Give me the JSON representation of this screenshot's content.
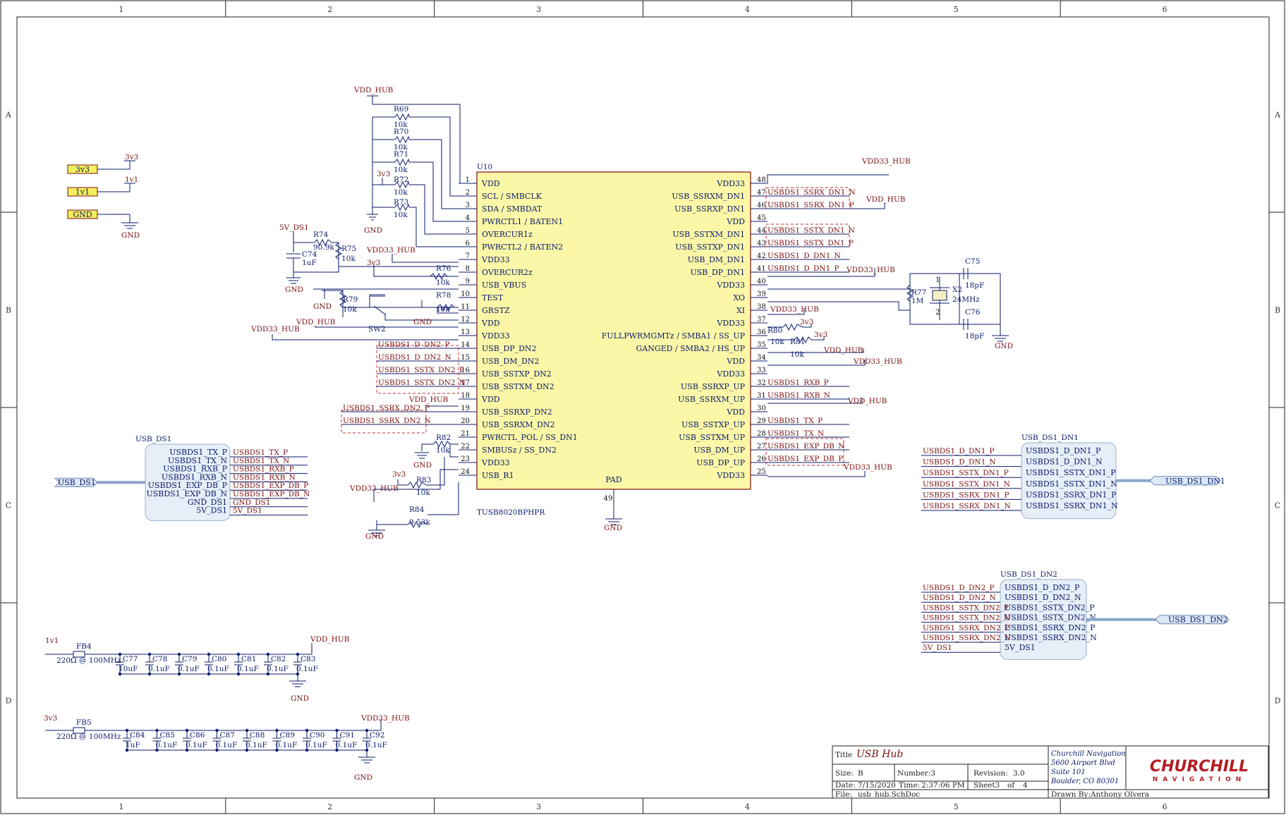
{
  "zones": {
    "columns": [
      "1",
      "2",
      "3",
      "4",
      "5",
      "6"
    ],
    "rows": [
      "A",
      "B",
      "C",
      "D"
    ]
  },
  "power_labels": {
    "top_left_ports": [
      {
        "label": "3v3",
        "net": "3v3"
      },
      {
        "label": "1v1",
        "net": "1v1"
      },
      {
        "label": "GND",
        "net": "GND"
      }
    ]
  },
  "ic": {
    "ref": "U10",
    "part": "TUSB8020BPHPR",
    "left_pins": [
      {
        "num": "1",
        "name": "VDD"
      },
      {
        "num": "2",
        "name": "SCL / SMBCLK"
      },
      {
        "num": "3",
        "name": "SDA / SMBDAT"
      },
      {
        "num": "4",
        "name": "PWRCTL1 / BATEN1"
      },
      {
        "num": "5",
        "name": "OVERCUR1z"
      },
      {
        "num": "6",
        "name": "PWRCTL2 / BATEN2"
      },
      {
        "num": "7",
        "name": "VDD33"
      },
      {
        "num": "8",
        "name": "OVERCUR2z"
      },
      {
        "num": "9",
        "name": "USB_VBUS"
      },
      {
        "num": "10",
        "name": "TEST"
      },
      {
        "num": "11",
        "name": "GRSTZ"
      },
      {
        "num": "12",
        "name": "VDD"
      },
      {
        "num": "13",
        "name": "VDD33"
      },
      {
        "num": "14",
        "name": "USB_DP_DN2"
      },
      {
        "num": "15",
        "name": "USB_DM_DN2"
      },
      {
        "num": "16",
        "name": "USB_SSTXP_DN2"
      },
      {
        "num": "17",
        "name": "USB_SSTXM_DN2"
      },
      {
        "num": "18",
        "name": "VDD"
      },
      {
        "num": "19",
        "name": "USB_SSRXP_DN2"
      },
      {
        "num": "20",
        "name": "USB_SSRXM_DN2"
      },
      {
        "num": "21",
        "name": "PWRCTL_POL / SS_DN1"
      },
      {
        "num": "22",
        "name": "SMBUSz / SS_DN2"
      },
      {
        "num": "23",
        "name": "VDD33"
      },
      {
        "num": "24",
        "name": "USB_R1"
      }
    ],
    "right_pins": [
      {
        "num": "48",
        "name": "VDD33"
      },
      {
        "num": "47",
        "name": "USB_SSRXM_DN1"
      },
      {
        "num": "46",
        "name": "USB_SSRXP_DN1"
      },
      {
        "num": "45",
        "name": "VDD"
      },
      {
        "num": "44",
        "name": "USB_SSTXM_DN1"
      },
      {
        "num": "43",
        "name": "USB_SSTXP_DN1"
      },
      {
        "num": "42",
        "name": "USB_DM_DN1"
      },
      {
        "num": "41",
        "name": "USB_DP_DN1"
      },
      {
        "num": "40",
        "name": "VDD33"
      },
      {
        "num": "39",
        "name": "XO"
      },
      {
        "num": "38",
        "name": "XI"
      },
      {
        "num": "37",
        "name": "VDD33"
      },
      {
        "num": "36",
        "name": "FULLPWRMGMTz / SMBA1 / SS_UP"
      },
      {
        "num": "35",
        "name": "GANGED / SMBA2 / HS_UP"
      },
      {
        "num": "34",
        "name": "VDD"
      },
      {
        "num": "33",
        "name": "VDD33"
      },
      {
        "num": "32",
        "name": "USB_SSRXP_UP"
      },
      {
        "num": "31",
        "name": "USB_SSRXM_UP"
      },
      {
        "num": "30",
        "name": "VDD"
      },
      {
        "num": "29",
        "name": "USB_SSTXP_UP"
      },
      {
        "num": "28",
        "name": "USB_SSTXM_UP"
      },
      {
        "num": "27",
        "name": "USB_DM_UP"
      },
      {
        "num": "26",
        "name": "USB_DP_UP"
      },
      {
        "num": "25",
        "name": "VDD33"
      }
    ],
    "pad_label": "PAD",
    "pad_num": "49"
  },
  "right_nets": {
    "r47": "USBDS1_SSRX_DN1_N",
    "r46": "USBDS1_SSRX_DN1_P",
    "r44": "USBDS1_SSTX_DN1_N",
    "r43": "USBDS1_SSTX_DN1_P",
    "r42": "USBDS1_D_DN1_N",
    "r41": "USBDS1_D_DN1_P",
    "r32": "USBDS1_RXB_P",
    "r31": "USBDS1_RXB_N",
    "r29": "USBDS1_TX_P",
    "r28": "USBDS1_TX_N",
    "r27": "USBDS1_EXP_DB_N",
    "r26": "USBDS1_EXP_DB_P"
  },
  "left_nets": {
    "l14": "USBDS1_D_DN2_P",
    "l15": "USBDS1_D_DN2_N",
    "l16": "USBDS1_SSTX_DN2_P",
    "l17": "USBDS1_SSTX_DN2_N",
    "l19": "USBDS1_SSRX_DN2_P",
    "l20": "USBDS1_SSRX_DN2_N"
  },
  "supplies": {
    "vdd_hub": "VDD_HUB",
    "vdd33_hub": "VDD33_HUB",
    "gnd": "GND",
    "v3v3": "3v3",
    "v1v1": "1v1",
    "v5_ds1": "5V_DS1"
  },
  "resistors": {
    "R69": {
      "ref": "R69",
      "val": "10k"
    },
    "R70": {
      "ref": "R70",
      "val": "10k"
    },
    "R71": {
      "ref": "R71",
      "val": "10k"
    },
    "R72": {
      "ref": "R72",
      "val": "10k"
    },
    "R73": {
      "ref": "R73",
      "val": "10k"
    },
    "R74": {
      "ref": "R74",
      "val": "90.9k"
    },
    "R75": {
      "ref": "R75",
      "val": "10k"
    },
    "R76": {
      "ref": "R76",
      "val": "10k"
    },
    "R78": {
      "ref": "R78",
      "val": "10k"
    },
    "R79": {
      "ref": "R79",
      "val": "10k"
    },
    "R82": {
      "ref": "R82",
      "val": "10k"
    },
    "R83": {
      "ref": "R83",
      "val": "10k"
    },
    "R84": {
      "ref": "R84",
      "val": "9.53k"
    },
    "R77": {
      "ref": "R77",
      "val": "1M"
    },
    "R80": {
      "ref": "R80",
      "val": "10k"
    },
    "R81": {
      "ref": "R81",
      "val": "10k"
    }
  },
  "misc_parts": {
    "C74": {
      "ref": "C74",
      "val": "1uF"
    },
    "SW2": "SW2",
    "C75": {
      "ref": "C75",
      "val": "18pF"
    },
    "C76": {
      "ref": "C76",
      "val": "18pF"
    },
    "X2": {
      "ref": "X2",
      "val": "24MHz"
    },
    "x2_pin1": "1",
    "x2_pin2": "2"
  },
  "harness_us": {
    "title": "USB_DS1",
    "port": "USB_DS1",
    "entries": [
      "USBDS1_TX_P",
      "USBDS1_TX_N",
      "USBDS1_RXB_P",
      "USBDS1_RXB_N",
      "USBDS1_EXP_DB_P",
      "USBDS1_EXP_DB_N",
      "GND_DS1",
      "5V_DS1"
    ],
    "nets": [
      "USBDS1_TX_P",
      "USBDS1_TX_N",
      "USBDS1_RXB_P",
      "USBDS1_RXB_N",
      "USBDS1_EXP_DB_P",
      "USBDS1_EXP_DB_N",
      "GND_DS1",
      "5V_DS1"
    ]
  },
  "harness_dn1": {
    "title": "USB_DS1_DN1",
    "port": "USB_DS1_DN1",
    "entries": [
      "USBDS1_D_DN1_P",
      "USBDS1_D_DN1_N",
      "USBDS1_SSTX_DN1_P",
      "USBDS1_SSTX_DN1_N",
      "USBDS1_SSRX_DN1_P",
      "USBDS1_SSRX_DN1_N"
    ],
    "nets": [
      "USBDS1_D_DN1_P",
      "USBDS1_D_DN1_N",
      "USBDS1_SSTX_DN1_P",
      "USBDS1_SSTX_DN1_N",
      "USBDS1_SSRX_DN1_P",
      "USBDS1_SSRX_DN1_N"
    ]
  },
  "harness_dn2": {
    "title": "USB_DS1_DN2",
    "port": "USB_DS1_DN2",
    "entries": [
      "USBDS1_D_DN2_P",
      "USBDS1_D_DN2_N",
      "USBDS1_SSTX_DN2_P",
      "USBDS1_SSTX_DN2_N",
      "USBDS1_SSRX_DN2_P",
      "USBDS1_SSRX_DN2_N",
      "5V_DS1"
    ],
    "nets": [
      "USBDS1_D_DN2_P",
      "USBDS1_D_DN2_N",
      "USBDS1_SSTX_DN2_P",
      "USBDS1_SSTX_DN2_N",
      "USBDS1_SSRX_DN2_P",
      "USBDS1_SSRX_DN2_N",
      "5V_DS1"
    ]
  },
  "decoupling_1v1": {
    "ferrite": {
      "ref": "FB4",
      "val": "220Ω @ 100MHz"
    },
    "caps": [
      {
        "ref": "C77",
        "val": "10uF"
      },
      {
        "ref": "C78",
        "val": "0.1uF"
      },
      {
        "ref": "C79",
        "val": "0.1uF"
      },
      {
        "ref": "C80",
        "val": "0.1uF"
      },
      {
        "ref": "C81",
        "val": "0.1uF"
      },
      {
        "ref": "C82",
        "val": "0.1uF"
      },
      {
        "ref": "C83",
        "val": "0.1uF"
      }
    ]
  },
  "decoupling_3v3": {
    "ferrite": {
      "ref": "FB5",
      "val": "220Ω @ 100MHz"
    },
    "caps": [
      {
        "ref": "C84",
        "val": "1uF"
      },
      {
        "ref": "C85",
        "val": "0.1uF"
      },
      {
        "ref": "C86",
        "val": "0.1uF"
      },
      {
        "ref": "C87",
        "val": "0.1uF"
      },
      {
        "ref": "C88",
        "val": "0.1uF"
      },
      {
        "ref": "C89",
        "val": "0.1uF"
      },
      {
        "ref": "C90",
        "val": "0.1uF"
      },
      {
        "ref": "C91",
        "val": "0.1uF"
      },
      {
        "ref": "C92",
        "val": "0.1uF"
      }
    ]
  },
  "title_block": {
    "title_label": "Title",
    "title": "USB Hub",
    "size_label": "Size:",
    "size": "B",
    "number_label": "Number:3",
    "revision_label": "Revision:",
    "revision": "3.0",
    "date_label": "Date:",
    "date": "7/15/2020",
    "time_label": "Time:",
    "time": "2:37:06 PM",
    "sheet_label": "Sheet3",
    "of_label": "of",
    "of_total": "4",
    "file_label": "File:",
    "file": "usb_hub.SchDoc",
    "company": [
      "Churchill Navigation",
      "5600 Airport Blvd",
      "Suite 101",
      "Boulder, CO 80301"
    ],
    "drawn_by_label": "Drawn By:",
    "drawn_by": "Anthony Olvera",
    "logo_top": "CHURCHILL",
    "logo_bottom": "NAVIGATION"
  },
  "colors": {
    "wire": "#0b1b6b",
    "ic_fill": "#fbf7a6",
    "ic_stroke": "#7a1010",
    "net": "#7a1010",
    "harness_fill": "#e6eef8",
    "logo": "#b41e23"
  }
}
